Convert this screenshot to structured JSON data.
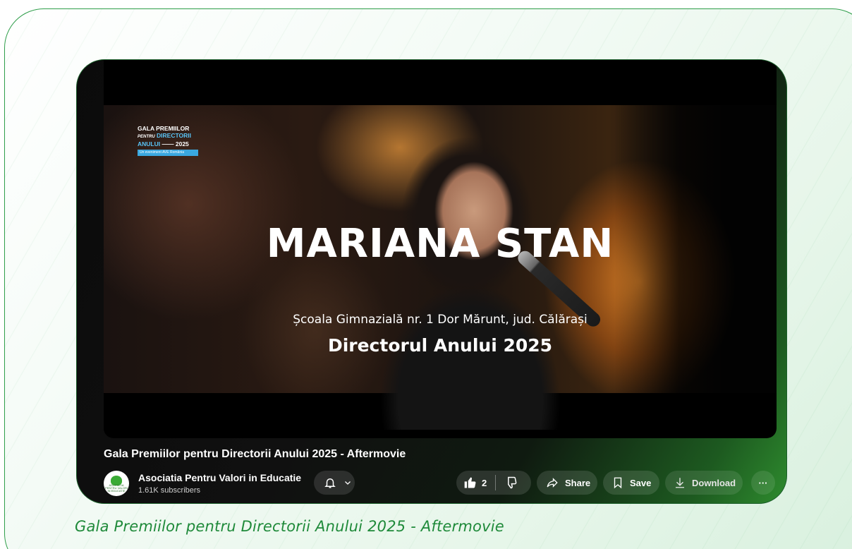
{
  "video": {
    "overlay_logo": {
      "line1": "GALA PREMIILOR",
      "line2_small": "PENTRU",
      "line2": "DIRECTORII",
      "line3": "ANULUI",
      "line3_year": "2025",
      "tag": "Un eveniment AVE România"
    },
    "headline": "MARIANA STAN",
    "school": "Școala Gimnazială nr. 1 Dor Mărunt, jud. Călărași",
    "award": "Directorul Anului 2025"
  },
  "title": "Gala Premiilor pentru Directorii Anului 2025 - Aftermovie",
  "channel": {
    "name": "Asociatia Pentru Valori in Educatie",
    "subscribers": "1.61K subscribers",
    "avatar_caption": "ASOCIATIA PENTRU VALORI IN EDUCATIE"
  },
  "actions": {
    "like_count": "2",
    "share_label": "Share",
    "save_label": "Save",
    "download_label": "Download",
    "more_label": "···"
  },
  "caption": "Gala Premiilor pentru Directorii Anului 2025 - Aftermovie",
  "icons": {
    "bell": "bell-icon",
    "chevron": "chevron-down-icon",
    "like": "thumbs-up-icon",
    "dislike": "thumbs-down-icon",
    "share": "share-arrow-icon",
    "save": "bookmark-icon",
    "download": "download-icon",
    "more": "more-icon"
  },
  "colors": {
    "accent_green": "#2f9e4a",
    "caption_green": "#1f8a3a"
  }
}
